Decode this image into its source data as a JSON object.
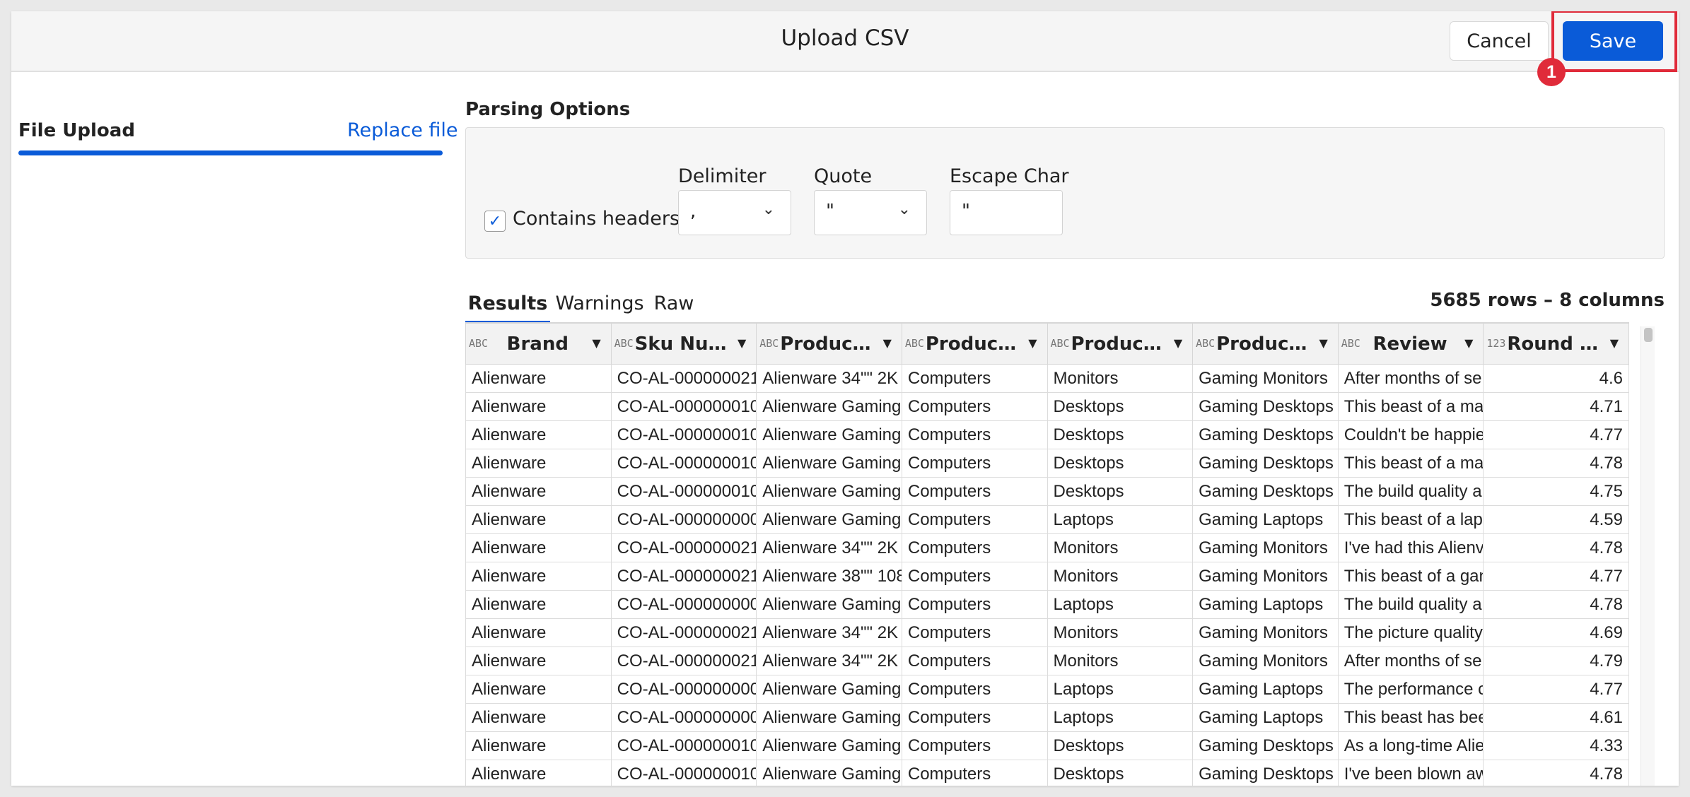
{
  "header": {
    "title": "Upload CSV",
    "cancel_label": "Cancel",
    "save_label": "Save",
    "step_badge": "1"
  },
  "sidebar": {
    "file_upload_label": "File Upload",
    "replace_file_label": "Replace file"
  },
  "parsing": {
    "title": "Parsing Options",
    "contains_headers_label": "Contains headers",
    "contains_headers_checked": true,
    "delimiter_label": "Delimiter",
    "delimiter_value": ",",
    "quote_label": "Quote",
    "quote_value": "\"",
    "escape_label": "Escape Char",
    "escape_value": "\""
  },
  "tabs": [
    {
      "label": "Results",
      "active": true
    },
    {
      "label": "Warnings",
      "active": false
    },
    {
      "label": "Raw",
      "active": false
    }
  ],
  "row_count": "5685 rows – 8 columns",
  "columns": [
    {
      "type": "ABC",
      "name": "Brand"
    },
    {
      "type": "ABC",
      "name": "Sku Nu…"
    },
    {
      "type": "ABC",
      "name": "Produc…"
    },
    {
      "type": "ABC",
      "name": "Produc…"
    },
    {
      "type": "ABC",
      "name": "Produc…"
    },
    {
      "type": "ABC",
      "name": "Produc…"
    },
    {
      "type": "ABC",
      "name": "Review"
    },
    {
      "type": "123",
      "name": "Round …"
    }
  ],
  "rows": [
    [
      "Alienware",
      "CO-AL-000000021",
      "Alienware 34\"\" 2K",
      "Computers",
      "Monitors",
      "Gaming Monitors",
      "After months of se",
      "4.6"
    ],
    [
      "Alienware",
      "CO-AL-000000010",
      "Alienware Gaming",
      "Computers",
      "Desktops",
      "Gaming Desktops",
      "This beast of a ma",
      "4.71"
    ],
    [
      "Alienware",
      "CO-AL-000000010",
      "Alienware Gaming",
      "Computers",
      "Desktops",
      "Gaming Desktops",
      "Couldn't be happie",
      "4.77"
    ],
    [
      "Alienware",
      "CO-AL-000000010",
      "Alienware Gaming",
      "Computers",
      "Desktops",
      "Gaming Desktops",
      "This beast of a ma",
      "4.78"
    ],
    [
      "Alienware",
      "CO-AL-000000010",
      "Alienware Gaming",
      "Computers",
      "Desktops",
      "Gaming Desktops",
      "The build quality a",
      "4.75"
    ],
    [
      "Alienware",
      "CO-AL-000000000",
      "Alienware Gaming",
      "Computers",
      "Laptops",
      "Gaming Laptops",
      "This beast of a lap",
      "4.59"
    ],
    [
      "Alienware",
      "CO-AL-000000021",
      "Alienware 34\"\" 2K",
      "Computers",
      "Monitors",
      "Gaming Monitors",
      "I've had this Alienv",
      "4.78"
    ],
    [
      "Alienware",
      "CO-AL-000000021",
      "Alienware 38\"\" 108",
      "Computers",
      "Monitors",
      "Gaming Monitors",
      "This beast of a gan",
      "4.77"
    ],
    [
      "Alienware",
      "CO-AL-000000000",
      "Alienware Gaming",
      "Computers",
      "Laptops",
      "Gaming Laptops",
      "The build quality a",
      "4.78"
    ],
    [
      "Alienware",
      "CO-AL-000000021",
      "Alienware 34\"\" 2K",
      "Computers",
      "Monitors",
      "Gaming Monitors",
      "The picture quality",
      "4.69"
    ],
    [
      "Alienware",
      "CO-AL-000000021",
      "Alienware 34\"\" 2K",
      "Computers",
      "Monitors",
      "Gaming Monitors",
      "After months of se",
      "4.79"
    ],
    [
      "Alienware",
      "CO-AL-000000000",
      "Alienware Gaming",
      "Computers",
      "Laptops",
      "Gaming Laptops",
      "The performance c",
      "4.77"
    ],
    [
      "Alienware",
      "CO-AL-000000000",
      "Alienware Gaming",
      "Computers",
      "Laptops",
      "Gaming Laptops",
      "This beast has bee",
      "4.61"
    ],
    [
      "Alienware",
      "CO-AL-000000010",
      "Alienware Gaming",
      "Computers",
      "Desktops",
      "Gaming Desktops",
      "As a long-time Alie",
      "4.33"
    ],
    [
      "Alienware",
      "CO-AL-000000010",
      "Alienware Gaming",
      "Computers",
      "Desktops",
      "Gaming Desktops",
      "I've been blown aw",
      "4.78"
    ]
  ],
  "colors": {
    "accent": "#0a5bd8",
    "highlight": "#e02b3a"
  },
  "icons": {
    "check": "check-icon",
    "chevron": "chevron-down-icon",
    "sort": "sort-caret-icon"
  }
}
